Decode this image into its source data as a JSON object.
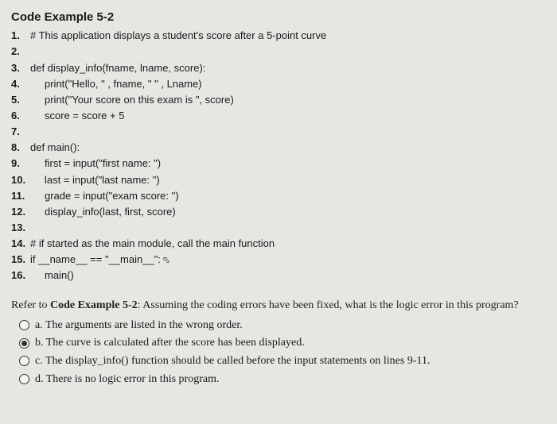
{
  "title": "Code Example 5-2",
  "code": {
    "l1": "# This application displays a student's score after a 5-point curve",
    "l2": "",
    "l3": "def display_info(fname, lname, score):",
    "l4": "print(\"Hello, \" , fname, \" \" , Lname)",
    "l5": "print(\"Your score on this exam is \", score)",
    "l6": "score = score + 5",
    "l7": "",
    "l8": "def main():",
    "l9": "first = input(\"first name: \")",
    "l10": "last = input(\"last name: \")",
    "l11": "grade = input(\"exam score: \")",
    "l12": "display_info(last, first, score)",
    "l13": "",
    "l14": "# if started as the main module, call the main function",
    "l15": "if __name__ == \"__main__\":",
    "l16": "main()"
  },
  "question": {
    "prefix": "Refer to ",
    "ref": "Code Example 5-2",
    "tail": ": Assuming the coding errors have been fixed, what is the logic error in this program?"
  },
  "options": {
    "a": "a. The arguments are listed in the wrong order.",
    "b": "b. The curve is calculated after the score has been displayed.",
    "c": "c. The display_info() function should be called before the input statements on lines 9-11.",
    "d": "d. There is no logic error in this program."
  },
  "selected": "b"
}
